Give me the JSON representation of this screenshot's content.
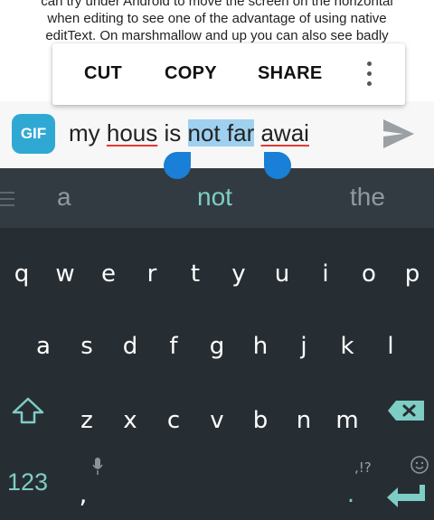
{
  "background_text": {
    "lines": [
      "can try under Android to move the screen on the horizontal",
      "when editing to see one of the advantage of using native",
      "editText. On marshmallow and up you can also see badly"
    ]
  },
  "context_menu": {
    "items": [
      "CUT",
      "COPY",
      "SHARE"
    ],
    "more_icon": "more-vert-icon"
  },
  "compose": {
    "gif_label": "GIF",
    "text_parts": [
      "my ",
      "hous",
      " is ",
      "not far",
      " ",
      "awai"
    ],
    "send_icon": "send-icon"
  },
  "suggestions": {
    "left": "a",
    "center": "not",
    "right": "the",
    "menu_icon": "menu-icon"
  },
  "keyboard": {
    "row1": [
      "q",
      "w",
      "e",
      "r",
      "t",
      "y",
      "u",
      "i",
      "o",
      "p"
    ],
    "row2": [
      "a",
      "s",
      "d",
      "f",
      "g",
      "h",
      "j",
      "k",
      "l"
    ],
    "row3": [
      "z",
      "x",
      "c",
      "v",
      "b",
      "n",
      "m"
    ],
    "symbols_key": "123",
    "comma": ",",
    "period": ".",
    "period_hint": ",!?",
    "shift_icon": "shift-icon",
    "backspace_icon": "backspace-icon",
    "mic_icon": "mic-icon",
    "emoji_icon": "emoji-icon",
    "enter_icon": "enter-icon",
    "accent_color": "#7ecdc5",
    "selection_color": "#9fd0ef",
    "handle_color": "#1a7fd6"
  }
}
